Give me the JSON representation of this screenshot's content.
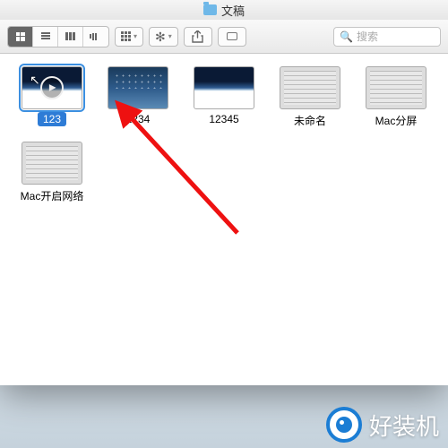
{
  "window": {
    "title": "文稿"
  },
  "toolbar": {
    "search_placeholder": "搜索"
  },
  "files": [
    {
      "name": "123",
      "selected": true,
      "thumb": "play"
    },
    {
      "name": "1234",
      "selected": false,
      "thumb": "desk"
    },
    {
      "name": "12345",
      "selected": false,
      "thumb": "horizon"
    },
    {
      "name": "未命名",
      "selected": false,
      "thumb": "screen"
    },
    {
      "name": "Mac分屏",
      "selected": false,
      "thumb": "screen"
    },
    {
      "name": "Mac开启网络",
      "selected": false,
      "thumb": "screen"
    }
  ],
  "watermark": {
    "text": "好装机"
  }
}
